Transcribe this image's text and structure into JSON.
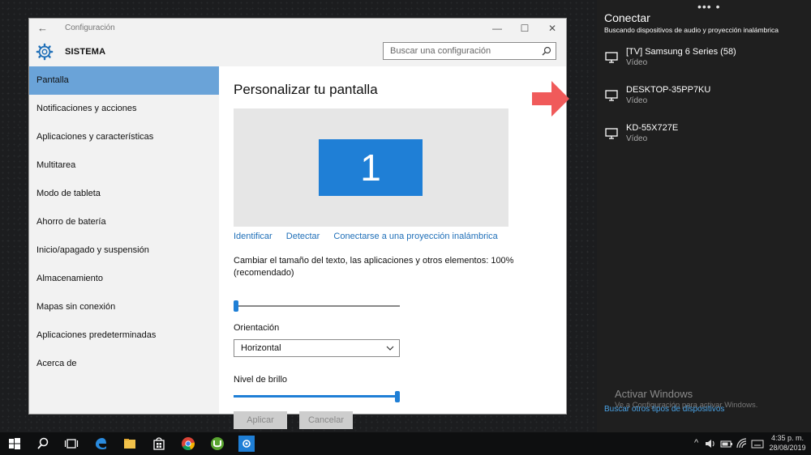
{
  "window": {
    "title": "Configuración",
    "section_title": "SISTEMA",
    "search_placeholder": "Buscar una configuración",
    "controls": {
      "minimize": "—",
      "maximize": "☐",
      "close": "✕"
    }
  },
  "sidebar": {
    "items": [
      {
        "label": "Pantalla",
        "active": true
      },
      {
        "label": "Notificaciones y acciones"
      },
      {
        "label": "Aplicaciones y características"
      },
      {
        "label": "Multitarea"
      },
      {
        "label": "Modo de tableta"
      },
      {
        "label": "Ahorro de batería"
      },
      {
        "label": "Inicio/apagado y suspensión"
      },
      {
        "label": "Almacenamiento"
      },
      {
        "label": "Mapas sin conexión"
      },
      {
        "label": "Aplicaciones predeterminadas"
      },
      {
        "label": "Acerca de"
      }
    ]
  },
  "main": {
    "title": "Personalizar tu pantalla",
    "monitor_number": "1",
    "links": {
      "identify": "Identificar",
      "detect": "Detectar",
      "wireless": "Conectarse a una proyección inalámbrica"
    },
    "scale_label": "Cambiar el tamaño del texto, las aplicaciones y otros elementos: 100% (recomendado)",
    "scale_value": 0,
    "orientation_label": "Orientación",
    "orientation_value": "Horizontal",
    "brightness_label": "Nivel de brillo",
    "brightness_value": 1,
    "apply_label": "Aplicar",
    "cancel_label": "Cancelar"
  },
  "connect_panel": {
    "dots": "•••  •",
    "title": "Conectar",
    "subtitle": "Buscando dispositivos de audio y proyección inalámbrica",
    "devices": [
      {
        "name": "[TV] Samsung 6 Series (58)",
        "type": "Vídeo"
      },
      {
        "name": "DESKTOP-35PP7KU",
        "type": "Vídeo"
      },
      {
        "name": "KD-55X727E",
        "type": "Vídeo"
      }
    ],
    "activate_title": "Activar Windows",
    "activate_sub": "Ve a Configuración para activar Windows.",
    "more_link": "Buscar otros tipos de dispositivos"
  },
  "taskbar": {
    "time": "4:35 p. m.",
    "date": "28/08/2019",
    "tray_up": "^"
  },
  "colors": {
    "accent": "#1f7fd6",
    "sidebar_active": "#6aa3d8",
    "link": "#1f6fb8",
    "arrow": "#f05a5a"
  }
}
